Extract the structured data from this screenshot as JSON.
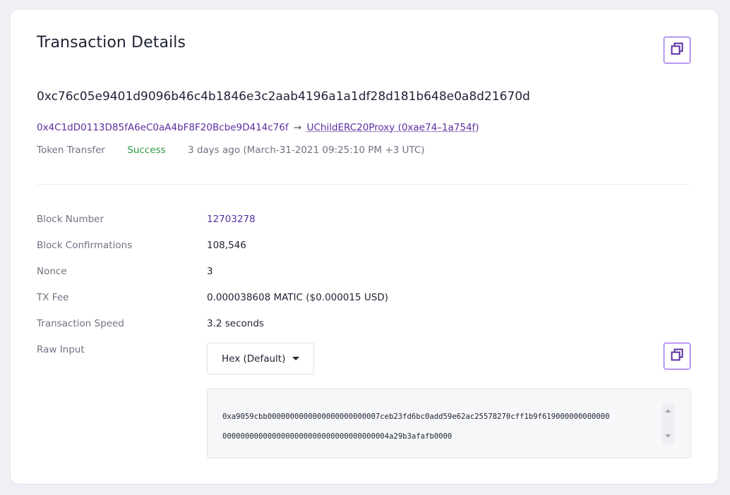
{
  "title": "Transaction Details",
  "tx_hash": "0xc76c05e9401d9096b46c4b1846e3c2aab4196a1a1df28d181b648e0a8d21670d",
  "from_address": "0x4C1dD0113D85fA6eC0aA4bF8F20Bcbe9D414c76f",
  "arrow": "→",
  "to_contract": "UChildERC20Proxy (0xae74–1a754f)",
  "tx_type": "Token Transfer",
  "status": "Success",
  "timestamp": "3 days ago (March-31-2021 09:25:10 PM +3 UTC)",
  "details": {
    "block_number_label": "Block Number",
    "block_number": "12703278",
    "confirmations_label": "Block Confirmations",
    "confirmations": "108,546",
    "nonce_label": "Nonce",
    "nonce": "3",
    "fee_label": "TX Fee",
    "fee": "0.000038608 MATIC ($0.000015 USD)",
    "speed_label": "Transaction Speed",
    "speed": "3.2 seconds",
    "raw_label": "Raw Input"
  },
  "raw_input": {
    "format_selected": "Hex (Default)",
    "line1": "0xa9059cbb0000000000000000000000007ceb23fd6bc0add59e62ac25578270cff1b9f619000000000000",
    "line2": "0000000000000000000000000000000000004a29b3afafb0000"
  },
  "colors": {
    "accent": "#7b3fe4",
    "link": "#5a2fa0",
    "success": "#2e9b43"
  },
  "icons": {
    "copy": "copy-icon",
    "caret": "chevron-down-icon",
    "scroll_up": "scroll-up-arrow-icon",
    "scroll_down": "scroll-down-arrow-icon"
  }
}
